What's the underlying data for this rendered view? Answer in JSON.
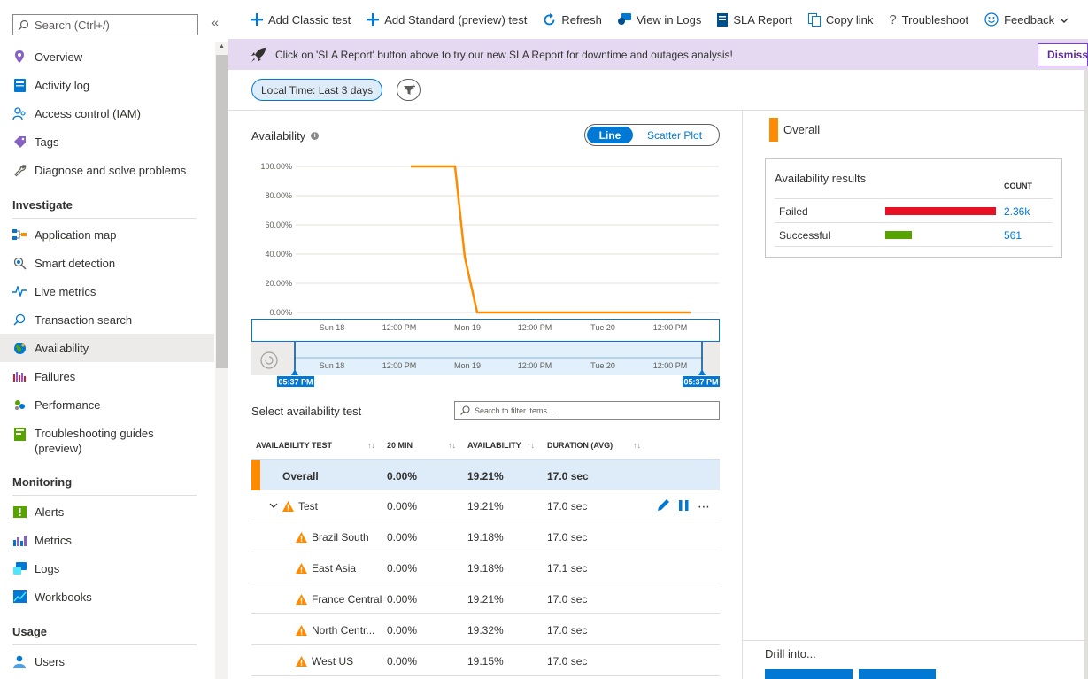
{
  "sidebar": {
    "search_placeholder": "Search (Ctrl+/)",
    "collapse": "«",
    "items": [
      {
        "label": "Overview",
        "icon": "overview-icon"
      },
      {
        "label": "Activity log",
        "icon": "activity-log-icon"
      },
      {
        "label": "Access control (IAM)",
        "icon": "iam-icon"
      },
      {
        "label": "Tags",
        "icon": "tags-icon"
      },
      {
        "label": "Diagnose and solve problems",
        "icon": "wrench-icon"
      }
    ],
    "investigate": {
      "title": "Investigate",
      "items": [
        {
          "label": "Application map",
          "icon": "application-map-icon"
        },
        {
          "label": "Smart detection",
          "icon": "smart-detection-icon"
        },
        {
          "label": "Live metrics",
          "icon": "live-metrics-icon"
        },
        {
          "label": "Transaction search",
          "icon": "search-icon"
        },
        {
          "label": "Availability",
          "icon": "globe-icon",
          "active": true
        },
        {
          "label": "Failures",
          "icon": "failures-icon"
        },
        {
          "label": "Performance",
          "icon": "performance-icon"
        },
        {
          "label": "Troubleshooting guides (preview)",
          "icon": "guides-icon"
        }
      ]
    },
    "monitoring": {
      "title": "Monitoring",
      "items": [
        {
          "label": "Alerts",
          "icon": "alerts-icon"
        },
        {
          "label": "Metrics",
          "icon": "metrics-icon"
        },
        {
          "label": "Logs",
          "icon": "logs-icon"
        },
        {
          "label": "Workbooks",
          "icon": "workbooks-icon"
        }
      ]
    },
    "usage": {
      "title": "Usage",
      "items": [
        {
          "label": "Users",
          "icon": "users-icon"
        }
      ]
    }
  },
  "toolbar": {
    "add_classic": "Add Classic test",
    "add_standard": "Add Standard (preview) test",
    "refresh": "Refresh",
    "view_logs": "View in Logs",
    "sla_report": "SLA Report",
    "copy_link": "Copy link",
    "troubleshoot": "Troubleshoot",
    "feedback": "Feedback"
  },
  "banner": {
    "text": "Click on 'SLA Report' button above to try our new SLA Report for downtime and outages analysis!",
    "dismiss": "Dismiss"
  },
  "filters": {
    "time": "Local Time: Last 3 days"
  },
  "chart": {
    "title": "Availability",
    "toggle_line": "Line",
    "toggle_scatter": "Scatter Plot",
    "brush_start": "05:37 PM",
    "brush_end": "05:37 PM"
  },
  "chart_data": {
    "type": "line",
    "title": "Availability",
    "yticks": [
      "100.00%",
      "80.00%",
      "60.00%",
      "40.00%",
      "20.00%",
      "0.00%"
    ],
    "ylim": [
      0,
      100
    ],
    "xticks": [
      "Sun 18",
      "12:00 PM",
      "Mon 19",
      "12:00 PM",
      "Tue 20",
      "12:00 PM"
    ],
    "series": [
      {
        "color": "#ff8c00",
        "x": [
          0.42,
          0.54,
          0.57,
          0.6,
          1.0
        ],
        "values": [
          100,
          100,
          38,
          0,
          0
        ]
      }
    ],
    "grid": true
  },
  "tests": {
    "title": "Select availability test",
    "filter_placeholder": "Search to filter items...",
    "columns": {
      "name": "AVAILABILITY TEST",
      "min20": "20 MIN",
      "availability": "AVAILABILITY",
      "duration": "DURATION (AVG)"
    },
    "overall": {
      "name": "Overall",
      "min20": "0.00%",
      "availability": "19.21%",
      "duration": "17.0 sec"
    },
    "rows": [
      {
        "name": "Test",
        "min20": "0.00%",
        "availability": "19.21%",
        "duration": "17.0 sec",
        "level": 1
      },
      {
        "name": "Brazil South",
        "min20": "0.00%",
        "availability": "19.18%",
        "duration": "17.0 sec",
        "level": 2
      },
      {
        "name": "East Asia",
        "min20": "0.00%",
        "availability": "19.18%",
        "duration": "17.1 sec",
        "level": 2
      },
      {
        "name": "France Central",
        "min20": "0.00%",
        "availability": "19.21%",
        "duration": "17.0 sec",
        "level": 2
      },
      {
        "name": "North Centr...",
        "min20": "0.00%",
        "availability": "19.32%",
        "duration": "17.0 sec",
        "level": 2
      },
      {
        "name": "West US",
        "min20": "0.00%",
        "availability": "19.15%",
        "duration": "17.0 sec",
        "level": 2
      }
    ]
  },
  "right_panel": {
    "legend": "Overall",
    "results_title": "Availability results",
    "count_header": "COUNT",
    "failed_label": "Failed",
    "failed_count": "2.36k",
    "failed_fraction": 1.0,
    "successful_label": "Successful",
    "successful_count": "561",
    "successful_fraction": 0.24,
    "drill_title": "Drill into..."
  },
  "colors": {
    "accent": "#0078d4",
    "orange": "#ff8c00",
    "failed": "#e81123",
    "success": "#57a300",
    "warning": "#ff8c00"
  }
}
